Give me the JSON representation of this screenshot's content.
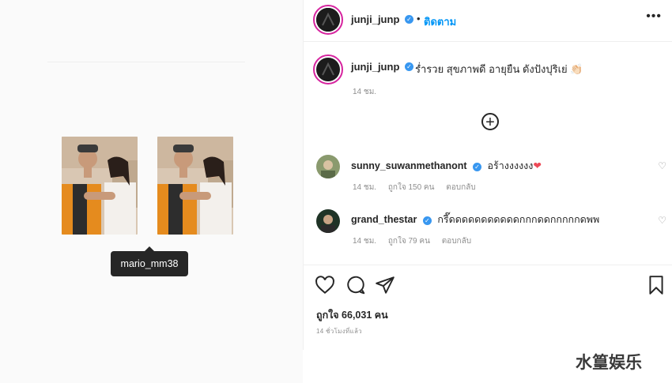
{
  "left": {
    "tooltip_username": "mario_mm38"
  },
  "header": {
    "username": "junji_junp",
    "separator": "•",
    "follow_label": "ติดตาม",
    "more_label": "•••"
  },
  "caption": {
    "username": "junji_junp",
    "text": "ร่ำรวย สุขภาพดี อายุยืน ดังปังปุริเย่ 👏🏻",
    "time": "14 ชม."
  },
  "comments": [
    {
      "username": "sunny_suwanmethanont",
      "text": "อร้างงงงงง",
      "emoji": "❤",
      "time": "14 ชม.",
      "likes": "ถูกใจ 150 คน",
      "reply": "ตอบกลับ"
    },
    {
      "username": "grand_thestar",
      "text": "กรี๊ดดดดดดดดดดดกกกดดกกกกกดพพ",
      "time": "14 ชม.",
      "likes": "ถูกใจ 79 คน",
      "reply": "ตอบกลับ"
    }
  ],
  "actions": {
    "likes_label": "ถูกใจ 66,031 คน",
    "timestamp": "14 ชั่วโมงที่แล้ว"
  },
  "watermark": "水篁娱乐",
  "colors": {
    "accent": "#0095f6",
    "verified": "#3897f0",
    "text": "#262626",
    "muted": "#8e8e8e",
    "heart": "#ed4956",
    "tooltip_bg": "#262626"
  },
  "icons": [
    "verified-badge-icon",
    "more-options-icon",
    "load-more-comments-icon",
    "like-comment-icon",
    "heart-icon",
    "comment-icon",
    "share-icon",
    "save-icon"
  ]
}
